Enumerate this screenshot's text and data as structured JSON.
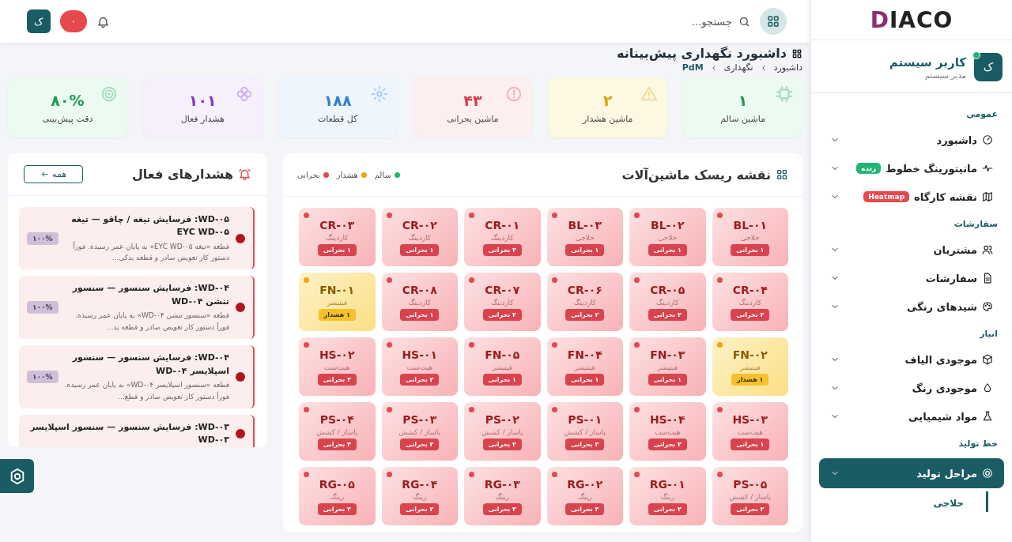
{
  "header": {
    "search": {
      "placeholder": "جستجو..."
    },
    "notification_count": "۰",
    "user_initial": "ک"
  },
  "page": {
    "title": "داشبورد نگهداری پیش‌بینانه",
    "breadcrumb": [
      "داشبورد",
      "نگهداری",
      "PdM"
    ]
  },
  "stats": [
    {
      "kind": "healthy",
      "value": "۱",
      "label": "ماشین سالم"
    },
    {
      "kind": "warning",
      "value": "۲",
      "label": "ماشین هشدار"
    },
    {
      "kind": "critical",
      "value": "۴۳",
      "label": "ماشین بحرانی"
    },
    {
      "kind": "parts",
      "value": "۱۸۸",
      "label": "کل قطعات"
    },
    {
      "kind": "alerts",
      "value": "۱۰۱",
      "label": "هشدار فعال"
    },
    {
      "kind": "accuracy",
      "value": "۸۰%",
      "label": "دقت پیش‌بینی"
    }
  ],
  "risk_map": {
    "title": "نقشه ریسک ماشین‌آلات",
    "legend": [
      {
        "label": "سالم",
        "color": "#22b573"
      },
      {
        "label": "هشدار",
        "color": "#f0a30a"
      },
      {
        "label": "بحرانی",
        "color": "#e5484d"
      }
    ],
    "machines": [
      {
        "id": "BL-۰۱",
        "type": "حلاجی",
        "kind": "critical",
        "badge": "۱ بحرانی"
      },
      {
        "id": "BL-۰۲",
        "type": "حلاجی",
        "kind": "critical",
        "badge": "۱ بحرانی"
      },
      {
        "id": "BL-۰۳",
        "type": "حلاجی",
        "kind": "critical",
        "badge": "۱ بحرانی"
      },
      {
        "id": "CR-۰۱",
        "type": "کاردینگ",
        "kind": "critical",
        "badge": "۳ بحرانی"
      },
      {
        "id": "CR-۰۲",
        "type": "کاردینگ",
        "kind": "critical",
        "badge": "۱ بحرانی"
      },
      {
        "id": "CR-۰۳",
        "type": "کاردینگ",
        "kind": "critical",
        "badge": "۱ بحرانی"
      },
      {
        "id": "CR-۰۴",
        "type": "کاردینگ",
        "kind": "critical",
        "badge": "۲ بحرانی"
      },
      {
        "id": "CR-۰۵",
        "type": "کاردینگ",
        "kind": "critical",
        "badge": "۲ بحرانی"
      },
      {
        "id": "CR-۰۶",
        "type": "کاردینگ",
        "kind": "critical",
        "badge": "۲ بحرانی"
      },
      {
        "id": "CR-۰۷",
        "type": "کاردینگ",
        "kind": "critical",
        "badge": "۲ بحرانی"
      },
      {
        "id": "CR-۰۸",
        "type": "کاردینگ",
        "kind": "critical",
        "badge": "۱ بحرانی"
      },
      {
        "id": "FN-۰۱",
        "type": "فینیشر",
        "kind": "warning",
        "badge": "۱ هشدار"
      },
      {
        "id": "FN-۰۲",
        "type": "فینیشر",
        "kind": "warning",
        "badge": "۱ هشدار"
      },
      {
        "id": "FN-۰۳",
        "type": "فینیشر",
        "kind": "critical",
        "badge": "۱ بحرانی"
      },
      {
        "id": "FN-۰۴",
        "type": "فینیشر",
        "kind": "critical",
        "badge": "۱ بحرانی"
      },
      {
        "id": "FN-۰۵",
        "type": "فینیشر",
        "kind": "critical",
        "badge": "۱ بحرانی"
      },
      {
        "id": "HS-۰۱",
        "type": "هیت‌ست",
        "kind": "critical",
        "badge": "۲ بحرانی"
      },
      {
        "id": "HS-۰۲",
        "type": "هیت‌ست",
        "kind": "critical",
        "badge": "۲ بحرانی"
      },
      {
        "id": "HS-۰۳",
        "type": "هیت‌ست",
        "kind": "critical",
        "badge": "۱ بحرانی"
      },
      {
        "id": "HS-۰۴",
        "type": "هیت‌ست",
        "kind": "critical",
        "badge": "۲ بحرانی"
      },
      {
        "id": "PS-۰۱",
        "type": "پاساز / کشش",
        "kind": "critical",
        "badge": "۳ بحرانی"
      },
      {
        "id": "PS-۰۲",
        "type": "پاساز / کشش",
        "kind": "critical",
        "badge": "۲ بحرانی"
      },
      {
        "id": "PS-۰۳",
        "type": "پاساز / کشش",
        "kind": "critical",
        "badge": "۲ بحرانی"
      },
      {
        "id": "PS-۰۴",
        "type": "پاساز / کشش",
        "kind": "critical",
        "badge": "۳ بحرانی"
      },
      {
        "id": "PS-۰۵",
        "type": "پاساز / کشش",
        "kind": "critical",
        "badge": "۲ بحرانی"
      },
      {
        "id": "RG-۰۱",
        "type": "رینگ",
        "kind": "critical",
        "badge": "۲ بحرانی"
      },
      {
        "id": "RG-۰۲",
        "type": "رینگ",
        "kind": "critical",
        "badge": "۳ بحرانی"
      },
      {
        "id": "RG-۰۳",
        "type": "رینگ",
        "kind": "critical",
        "badge": "۳ بحرانی"
      },
      {
        "id": "RG-۰۴",
        "type": "رینگ",
        "kind": "critical",
        "badge": "۲ بحرانی"
      },
      {
        "id": "RG-۰۵",
        "type": "رینگ",
        "kind": "critical",
        "badge": "۲ بحرانی"
      }
    ]
  },
  "alerts": {
    "title": "هشدارهای فعال",
    "all_button": "همه",
    "items": [
      {
        "title": "WD-۰۵: فرسایش تیغه / چاقو — تیغه EYC WD-۰۵",
        "text": "قطعه «تیغه EYC WD-۰۵» به پایان عمر رسیده. فوراً دستور کار تعویض صادر و قطعه یدکی...",
        "score": "۱۰۰%"
      },
      {
        "title": "WD-۰۴: فرسایش سنسور — سنسور تنشن WD-۰۴",
        "text": "قطعه «سنسور تنشن WD-۰۴» به پایان عمر رسیده. فوراً دستور کار تعویض صادر و قطعه ید...",
        "score": "۱۰۰%"
      },
      {
        "title": "WD-۰۴: فرسایش سنسور — سنسور اسپلایسر WD-۰۴",
        "text": "قطعه «سنسور اسپلایسر WD-۰۴» به پایان عمر رسیده. فوراً دستور کار تعویض صادر و قطع...",
        "score": "۱۰۰%"
      },
      {
        "title": "WD-۰۳: فرسایش سنسور — سنسور اسپلایسر WD-۰۳"
      }
    ]
  },
  "sidebar": {
    "logo": "DIACO",
    "user": {
      "initial": "ک",
      "name": "کاربر سیستم",
      "role": "مدیر سیستم",
      "online": true
    },
    "sections": [
      {
        "title": "عمومی",
        "items": [
          {
            "label": "داشبورد",
            "selected": false
          },
          {
            "label": "مانیتورینگ خطوط",
            "selected": false,
            "badge": {
              "text": "زنده",
              "color": "#22b573"
            }
          },
          {
            "label": "نقشه کارگاه",
            "selected": false,
            "badge": {
              "text": "Heatmap",
              "color": "#e5484d"
            }
          }
        ]
      },
      {
        "title": "سفارشات",
        "items": [
          {
            "label": "مشتریان",
            "selected": false
          },
          {
            "label": "سفارشات",
            "selected": false
          },
          {
            "label": "شیدهای رنگی",
            "selected": false
          }
        ]
      },
      {
        "title": "انبار",
        "items": [
          {
            "label": "موجودی الیاف",
            "selected": false
          },
          {
            "label": "موجودی رنگ",
            "selected": false
          },
          {
            "label": "مواد شیمیایی",
            "selected": false
          }
        ]
      },
      {
        "title": "خط تولید",
        "items": [
          {
            "label": "مراحل تولید",
            "selected": true,
            "children": [
              {
                "label": "حلاجی"
              }
            ]
          }
        ]
      }
    ]
  }
}
